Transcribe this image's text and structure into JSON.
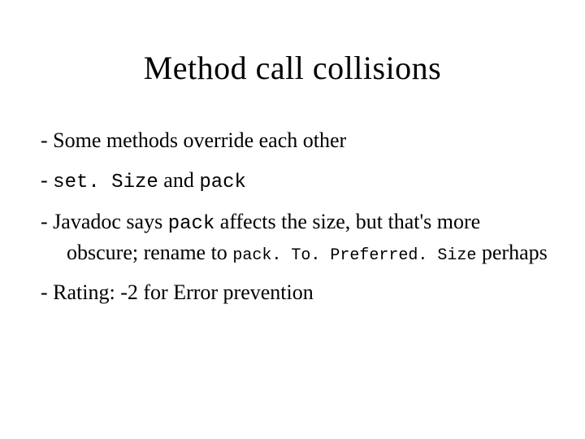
{
  "slide": {
    "title": "Method call collisions",
    "bullets": {
      "b1": {
        "text": "Some methods override each other"
      },
      "b2": {
        "code1": "set. Size",
        "mid": " and ",
        "code2": "pack"
      },
      "b3": {
        "pre": "Javadoc says ",
        "code1": "pack",
        "mid": " affects the size, but that's more obscure; rename to ",
        "code2": "pack. To. Preferred. Size",
        "post": " perhaps"
      },
      "b4": {
        "text": "Rating: -2 for Error prevention"
      }
    }
  }
}
